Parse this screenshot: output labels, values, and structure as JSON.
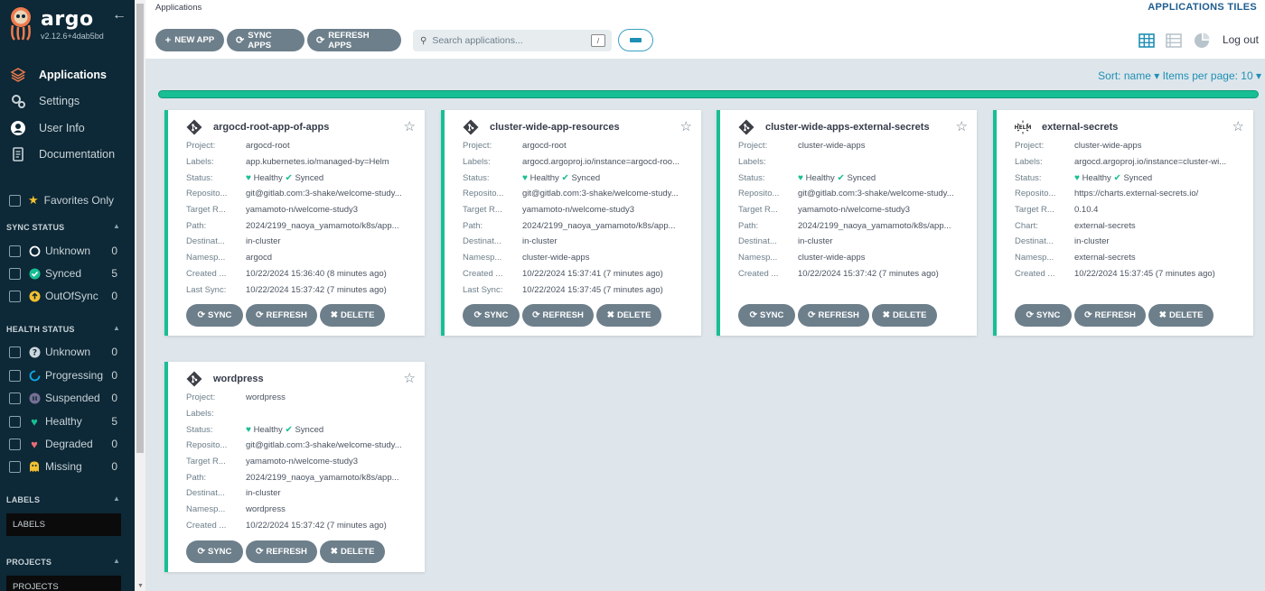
{
  "sidebar": {
    "brand": "argo",
    "version": "v2.12.6+4dab5bd",
    "nav": [
      {
        "label": "Applications",
        "icon": "layers-icon"
      },
      {
        "label": "Settings",
        "icon": "gears-icon"
      },
      {
        "label": "User Info",
        "icon": "user-icon"
      },
      {
        "label": "Documentation",
        "icon": "docs-icon"
      }
    ],
    "favorites_label": "Favorites Only",
    "sync_status": {
      "title": "SYNC STATUS",
      "items": [
        {
          "label": "Unknown",
          "count": "0"
        },
        {
          "label": "Synced",
          "count": "5"
        },
        {
          "label": "OutOfSync",
          "count": "0"
        }
      ]
    },
    "health_status": {
      "title": "HEALTH STATUS",
      "items": [
        {
          "label": "Unknown",
          "count": "0"
        },
        {
          "label": "Progressing",
          "count": "0"
        },
        {
          "label": "Suspended",
          "count": "0"
        },
        {
          "label": "Healthy",
          "count": "5"
        },
        {
          "label": "Degraded",
          "count": "0"
        },
        {
          "label": "Missing",
          "count": "0"
        }
      ]
    },
    "labels": {
      "title": "LABELS",
      "placeholder": "LABELS"
    },
    "projects": {
      "title": "PROJECTS",
      "placeholder": "PROJECTS"
    }
  },
  "header": {
    "breadcrumb": "Applications",
    "view_title": "APPLICATIONS TILES",
    "new_app": "NEW APP",
    "sync_apps": "SYNC APPS",
    "refresh_apps": "REFRESH APPS",
    "search_placeholder": "Search applications...",
    "search_shortcut": "/",
    "logout": "Log out"
  },
  "content": {
    "sort": "Sort: name",
    "items_per_page": "Items per page: 10"
  },
  "card_buttons": {
    "sync": "SYNC",
    "refresh": "REFRESH",
    "delete": "DELETE"
  },
  "status_text": {
    "healthy": "Healthy",
    "synced": "Synced"
  },
  "apps": [
    {
      "name": "argocd-root-app-of-apps",
      "rows": [
        {
          "k": "Project:",
          "v": "argocd-root"
        },
        {
          "k": "Labels:",
          "v": "app.kubernetes.io/managed-by=Helm"
        },
        {
          "k": "Status:",
          "v": ""
        },
        {
          "k": "Reposito...",
          "v": "git@gitlab.com:3-shake/welcome-study..."
        },
        {
          "k": "Target R...",
          "v": "yamamoto-n/welcome-study3"
        },
        {
          "k": "Path:",
          "v": "2024/2199_naoya_yamamoto/k8s/app..."
        },
        {
          "k": "Destinat...",
          "v": "in-cluster"
        },
        {
          "k": "Namesp...",
          "v": "argocd"
        },
        {
          "k": "Created ...",
          "v": "10/22/2024 15:36:40  (8 minutes ago)"
        },
        {
          "k": "Last Sync:",
          "v": "10/22/2024 15:37:42  (7 minutes ago)"
        }
      ]
    },
    {
      "name": "cluster-wide-app-resources",
      "rows": [
        {
          "k": "Project:",
          "v": "argocd-root"
        },
        {
          "k": "Labels:",
          "v": "argocd.argoproj.io/instance=argocd-roo..."
        },
        {
          "k": "Status:",
          "v": ""
        },
        {
          "k": "Reposito...",
          "v": "git@gitlab.com:3-shake/welcome-study..."
        },
        {
          "k": "Target R...",
          "v": "yamamoto-n/welcome-study3"
        },
        {
          "k": "Path:",
          "v": "2024/2199_naoya_yamamoto/k8s/app..."
        },
        {
          "k": "Destinat...",
          "v": "in-cluster"
        },
        {
          "k": "Namesp...",
          "v": "cluster-wide-apps"
        },
        {
          "k": "Created ...",
          "v": "10/22/2024 15:37:41  (7 minutes ago)"
        },
        {
          "k": "Last Sync:",
          "v": "10/22/2024 15:37:45  (7 minutes ago)"
        }
      ]
    },
    {
      "name": "cluster-wide-apps-external-secrets",
      "rows": [
        {
          "k": "Project:",
          "v": "cluster-wide-apps"
        },
        {
          "k": "Labels:",
          "v": ""
        },
        {
          "k": "Status:",
          "v": ""
        },
        {
          "k": "Reposito...",
          "v": "git@gitlab.com:3-shake/welcome-study..."
        },
        {
          "k": "Target R...",
          "v": "yamamoto-n/welcome-study3"
        },
        {
          "k": "Path:",
          "v": "2024/2199_naoya_yamamoto/k8s/app..."
        },
        {
          "k": "Destinat...",
          "v": "in-cluster"
        },
        {
          "k": "Namesp...",
          "v": "cluster-wide-apps"
        },
        {
          "k": "Created ...",
          "v": "10/22/2024 15:37:42  (7 minutes ago)"
        }
      ]
    },
    {
      "name": "external-secrets",
      "rows": [
        {
          "k": "Project:",
          "v": "cluster-wide-apps"
        },
        {
          "k": "Labels:",
          "v": "argocd.argoproj.io/instance=cluster-wi..."
        },
        {
          "k": "Status:",
          "v": ""
        },
        {
          "k": "Reposito...",
          "v": "https://charts.external-secrets.io/"
        },
        {
          "k": "Target R...",
          "v": "0.10.4"
        },
        {
          "k": "Chart:",
          "v": "external-secrets"
        },
        {
          "k": "Destinat...",
          "v": "in-cluster"
        },
        {
          "k": "Namesp...",
          "v": "external-secrets"
        },
        {
          "k": "Created ...",
          "v": "10/22/2024 15:37:45  (7 minutes ago)"
        }
      ]
    },
    {
      "name": "wordpress",
      "rows": [
        {
          "k": "Project:",
          "v": "wordpress"
        },
        {
          "k": "Labels:",
          "v": ""
        },
        {
          "k": "Status:",
          "v": ""
        },
        {
          "k": "Reposito...",
          "v": "git@gitlab.com:3-shake/welcome-study..."
        },
        {
          "k": "Target R...",
          "v": "yamamoto-n/welcome-study3"
        },
        {
          "k": "Path:",
          "v": "2024/2199_naoya_yamamoto/k8s/app..."
        },
        {
          "k": "Destinat...",
          "v": "in-cluster"
        },
        {
          "k": "Namesp...",
          "v": "wordpress"
        },
        {
          "k": "Created ...",
          "v": "10/22/2024 15:37:42  (7 minutes ago)"
        }
      ]
    }
  ]
}
